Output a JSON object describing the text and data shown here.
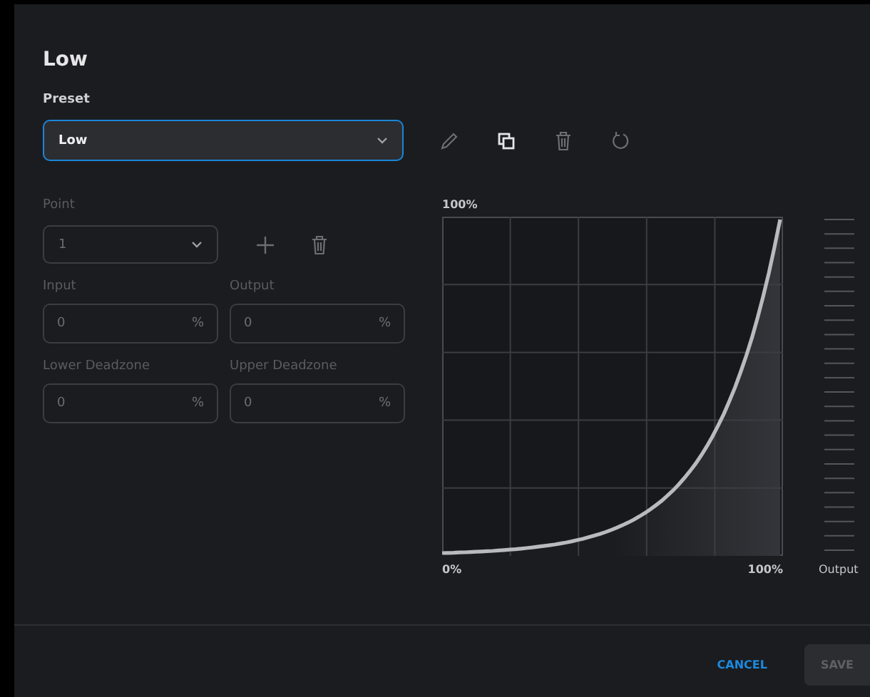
{
  "dialog": {
    "title": "Low"
  },
  "preset": {
    "label": "Preset",
    "value": "Low",
    "focused": true
  },
  "preset_actions": [
    {
      "kind": "edit",
      "disabled": true
    },
    {
      "kind": "copy",
      "disabled": false
    },
    {
      "kind": "delete",
      "disabled": true
    },
    {
      "kind": "reset",
      "disabled": true
    }
  ],
  "point": {
    "label": "Point",
    "value": "1",
    "disabled": true
  },
  "point_actions": [
    {
      "kind": "add",
      "disabled": true
    },
    {
      "kind": "delete",
      "disabled": true
    }
  ],
  "fields": [
    {
      "label": "Input",
      "value": "0",
      "unit": "%",
      "disabled": true
    },
    {
      "label": "Output",
      "value": "0",
      "unit": "%",
      "disabled": true
    },
    {
      "label": "Lower Deadzone",
      "value": "0",
      "unit": "%",
      "disabled": true
    },
    {
      "label": "Upper Deadzone",
      "value": "0",
      "unit": "%",
      "disabled": true
    }
  ],
  "chart": {
    "y_max_label": "100%",
    "x_min_label": "0%",
    "x_max_label": "100%",
    "meter_label": "Output"
  },
  "buttons": [
    {
      "label": "CANCEL",
      "kind": "text",
      "disabled": false
    },
    {
      "label": "SAVE",
      "kind": "filled",
      "disabled": true
    }
  ]
}
